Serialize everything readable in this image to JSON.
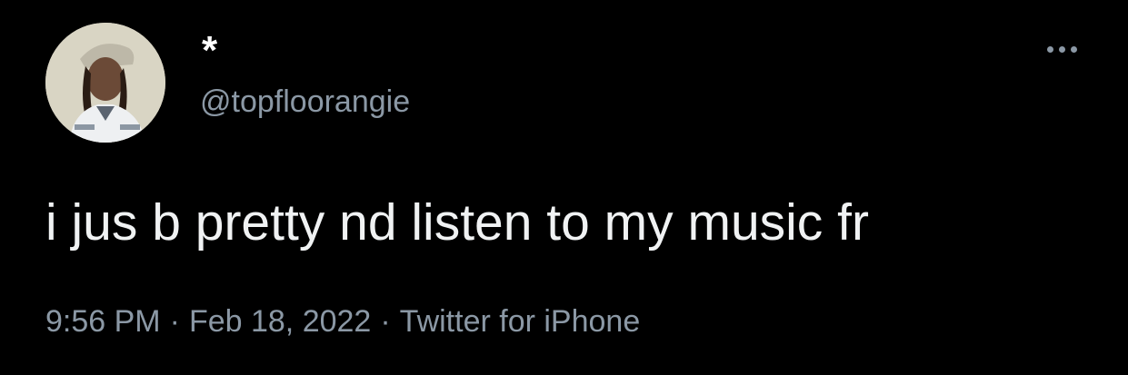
{
  "tweet": {
    "display_name": "*",
    "handle": "@topfloorangie",
    "text": "i jus b pretty nd listen to my music fr",
    "time": "9:56 PM",
    "date": "Feb 18, 2022",
    "source": "Twitter for iPhone",
    "separator": "·"
  },
  "icons": {
    "more": "more-horizontal-icon",
    "avatar": "profile-photo"
  },
  "colors": {
    "background": "#000000",
    "primary_text": "#e7e9ea",
    "secondary_text": "#8b98a5"
  }
}
